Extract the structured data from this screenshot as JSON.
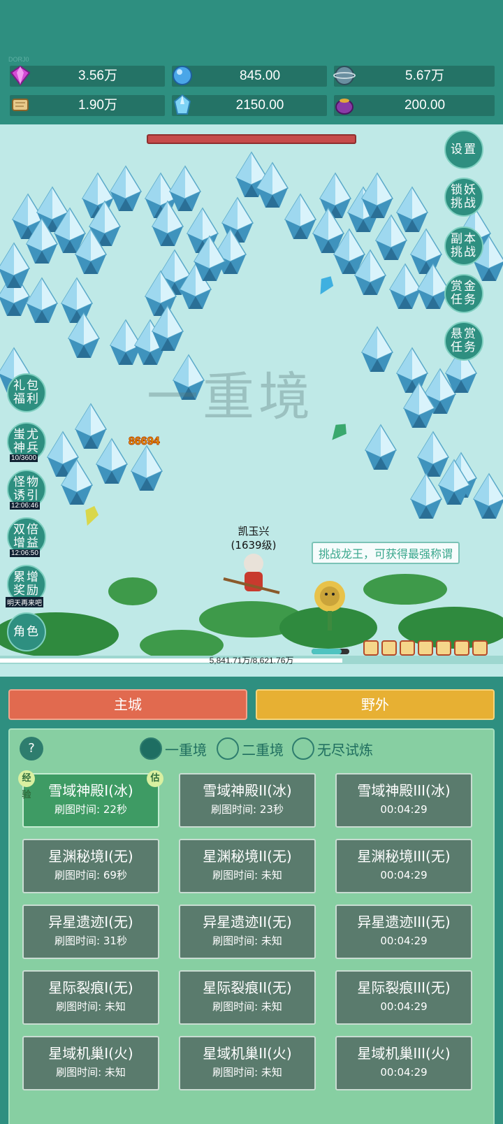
{
  "user_id": "DORJ0",
  "resources": [
    {
      "icon": "purple-gem-icon",
      "value": "3.56万"
    },
    {
      "icon": "blue-crystal-orb-icon",
      "value": "845.00"
    },
    {
      "icon": "planet-globe-icon",
      "value": "5.67万"
    },
    {
      "icon": "scroll-icon",
      "value": "1.90万"
    },
    {
      "icon": "ice-crystal-icon",
      "value": "2150.00"
    },
    {
      "icon": "treasure-pot-icon",
      "value": "200.00"
    }
  ],
  "right_menu": [
    "设置",
    "锁妖挑战",
    "副本挑战",
    "赏金任务",
    "悬赏任务"
  ],
  "left_menu": [
    {
      "label": "礼包福利",
      "sub": ""
    },
    {
      "label": "蚩尤神兵",
      "sub": "10/3600"
    },
    {
      "label": "怪物诱引",
      "sub": "12:06:46"
    },
    {
      "label": "双倍增益",
      "sub": "12:06:50"
    },
    {
      "label": "累增奖励",
      "sub": "明天再来吧"
    },
    {
      "label": "角色",
      "sub": ""
    }
  ],
  "realm_watermark": "一重境",
  "damage_number": "86694",
  "hero": {
    "name": "凯玉兴",
    "level": "(1639级)",
    "hp_fraction": 0.8
  },
  "challenge_tip": "挑战龙王，可获得最强称谓",
  "exp": {
    "text": "5,841.71万/8,621.76万",
    "fraction": 0.68
  },
  "buttons": {
    "city": "主城",
    "wild": "野外"
  },
  "help_label": "?",
  "tiers": [
    {
      "label": "一重境",
      "selected": true
    },
    {
      "label": "二重境",
      "selected": false
    },
    {
      "label": "无尽试炼",
      "selected": false
    }
  ],
  "badges": {
    "left": "经验",
    "right": "估"
  },
  "maps": [
    {
      "name": "雪域神殿I(冰)",
      "time": "刷图时间: 22秒",
      "selected": true
    },
    {
      "name": "雪域神殿II(冰)",
      "time": "刷图时间: 23秒"
    },
    {
      "name": "雪域神殿III(冰)",
      "time": "00:04:29"
    },
    {
      "name": "星渊秘境I(无)",
      "time": "刷图时间: 69秒"
    },
    {
      "name": "星渊秘境II(无)",
      "time": "刷图时间: 未知"
    },
    {
      "name": "星渊秘境III(无)",
      "time": "00:04:29"
    },
    {
      "name": "异星遗迹I(无)",
      "time": "刷图时间: 31秒"
    },
    {
      "name": "异星遗迹II(无)",
      "time": "刷图时间: 未知"
    },
    {
      "name": "异星遗迹III(无)",
      "time": "00:04:29"
    },
    {
      "name": "星际裂痕I(无)",
      "time": "刷图时间: 未知"
    },
    {
      "name": "星际裂痕II(无)",
      "time": "刷图时间: 未知"
    },
    {
      "name": "星际裂痕III(无)",
      "time": "00:04:29"
    },
    {
      "name": "星域机巢I(火)",
      "time": "刷图时间: 未知"
    },
    {
      "name": "星域机巢II(火)",
      "time": "刷图时间: 未知"
    },
    {
      "name": "星域机巢III(火)",
      "time": "00:04:29"
    }
  ],
  "colors": {
    "theme": "#2e8f80",
    "scene_bg": "#bfe9e7",
    "city": "#e16a4f",
    "wild": "#e7b033",
    "panel": "#87cfa2"
  }
}
